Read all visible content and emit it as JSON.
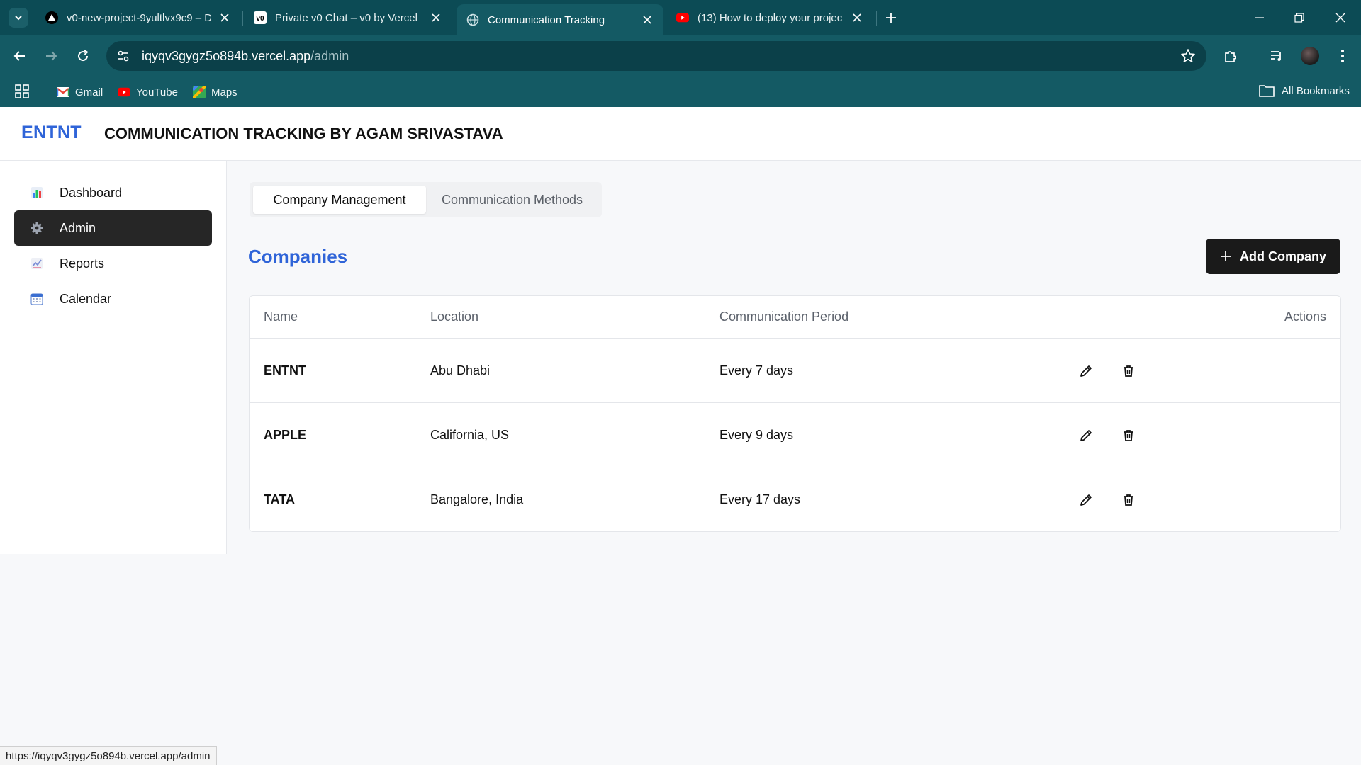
{
  "browser": {
    "tabs": [
      {
        "title": "v0-new-project-9yultlvx9c9 – D",
        "active": false,
        "favicon": "vercel-triangle-icon"
      },
      {
        "title": "Private v0 Chat – v0 by Vercel",
        "active": false,
        "favicon": "v0-icon"
      },
      {
        "title": "Communication Tracking",
        "active": true,
        "favicon": "globe-icon"
      },
      {
        "title": "(13) How to deploy your projec",
        "active": false,
        "favicon": "youtube-icon"
      }
    ],
    "url_host": "iqyqv3gygz5o894b.vercel.app",
    "url_path": "/admin",
    "bookmarks": [
      "Gmail",
      "YouTube",
      "Maps"
    ],
    "all_bookmarks": "All Bookmarks",
    "status_url": "https://iqyqv3gygz5o894b.vercel.app/admin"
  },
  "app": {
    "brand": "ENTNT",
    "title": "COMMUNICATION TRACKING BY AGAM SRIVASTAVA",
    "accent_color": "#2f64d8"
  },
  "sidebar": {
    "items": [
      {
        "label": "Dashboard",
        "icon": "bar-chart-icon",
        "active": false
      },
      {
        "label": "Admin",
        "icon": "gear-icon",
        "active": true
      },
      {
        "label": "Reports",
        "icon": "line-chart-icon",
        "active": false
      },
      {
        "label": "Calendar",
        "icon": "calendar-icon",
        "active": false
      }
    ]
  },
  "main": {
    "tabs": [
      {
        "label": "Company Management",
        "active": true
      },
      {
        "label": "Communication Methods",
        "active": false
      }
    ],
    "section_title": "Companies",
    "add_button": "Add Company",
    "table": {
      "headers": [
        "Name",
        "Location",
        "Communication Period",
        "Actions"
      ],
      "rows": [
        {
          "name": "ENTNT",
          "location": "Abu Dhabi",
          "period": "Every 7 days"
        },
        {
          "name": "APPLE",
          "location": "California, US",
          "period": "Every 9 days"
        },
        {
          "name": "TATA",
          "location": "Bangalore, India",
          "period": "Every 17 days"
        }
      ]
    }
  }
}
